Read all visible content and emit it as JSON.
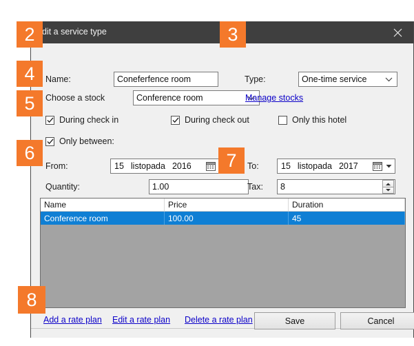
{
  "window": {
    "title": "dit a service type",
    "close_icon": "close-icon"
  },
  "form": {
    "name_label": "Name:",
    "name_value": "Coneferfence room",
    "type_label": "Type:",
    "type_value": "One-time service",
    "stock_label": "Choose a stock",
    "stock_value": "Conference room",
    "manage_stocks_link": "Manage stocks",
    "checkbox_during_check_in": "During check in",
    "checkbox_during_check_out": "During check out",
    "checkbox_only_this_hotel": "Only this hotel",
    "checkbox_only_between": "Only between:",
    "from_label": "From:",
    "from_day": "15",
    "from_month": "listopada",
    "from_year": "2016",
    "to_label": "To:",
    "to_day": "15",
    "to_month": "listopada",
    "to_year": "2017",
    "quantity_label": "Quantity:",
    "quantity_value": "1.00",
    "tax_label": "Tax:",
    "tax_value": "8"
  },
  "table": {
    "columns": [
      "Name",
      "Price",
      "Duration"
    ],
    "rows": [
      {
        "name": "Conference room",
        "price": "100.00",
        "duration": "45"
      }
    ]
  },
  "footer": {
    "add_rate_plan": "Add a rate plan",
    "edit_rate_plan": "Edit a rate plan",
    "delete_rate_plan": "Delete a rate plan",
    "save_label": "Save",
    "cancel_label": "Cancel"
  },
  "annotations": {
    "badge_2": "2",
    "badge_3": "3",
    "badge_4": "4",
    "badge_5": "5",
    "badge_6": "6",
    "badge_7": "7",
    "badge_8": "8"
  },
  "colors": {
    "accent_orange": "#f4792b",
    "selection_blue": "#0f7fd4",
    "titlebar": "#3f3f3f",
    "link_blue": "#0b00c8"
  }
}
